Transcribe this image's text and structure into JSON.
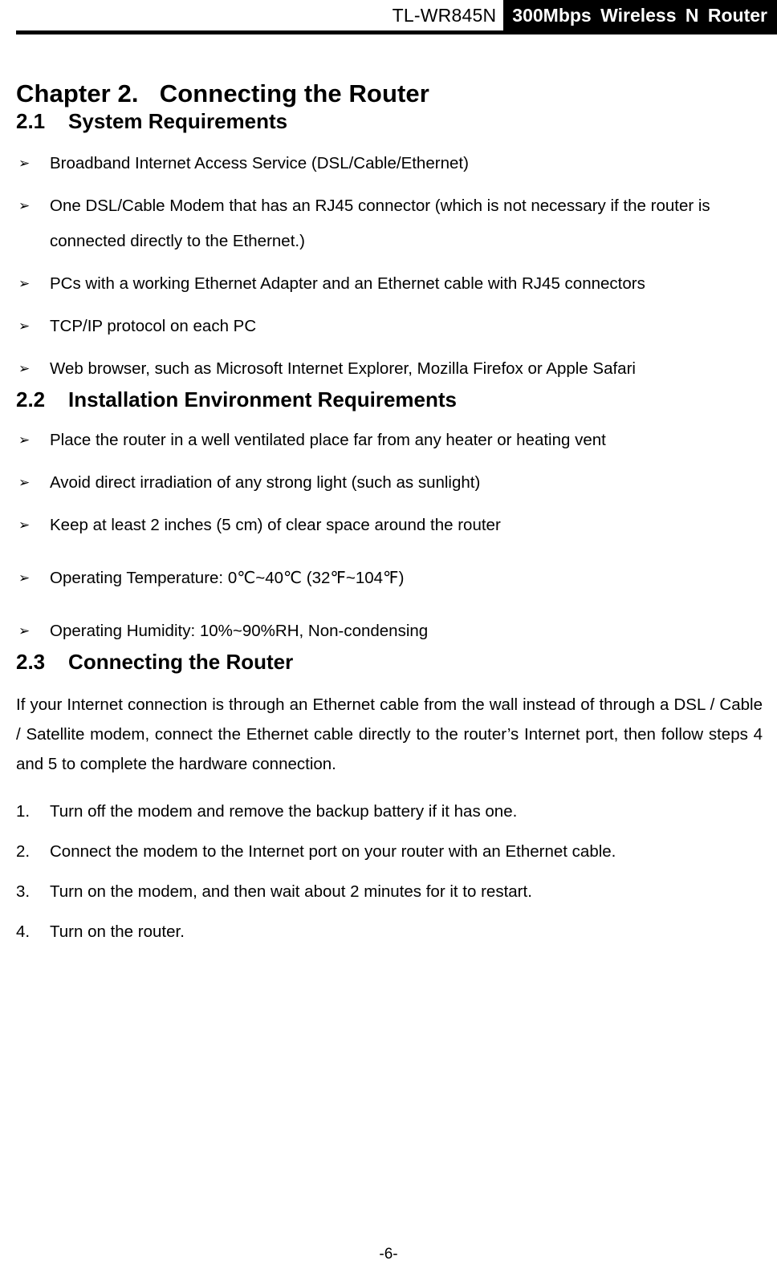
{
  "header": {
    "model": "TL-WR845N",
    "product": "300Mbps  Wireless  N  Router"
  },
  "chapter": {
    "title": "Chapter 2.   Connecting the Router"
  },
  "sections": [
    {
      "number": "2.1",
      "title": "2.1    System Requirements",
      "bullets": [
        "Broadband Internet Access Service (DSL/Cable/Ethernet)",
        "One DSL/Cable Modem that has an RJ45 connector (which is not necessary if the router is connected directly to the Ethernet.)",
        "PCs with a working Ethernet Adapter and an Ethernet cable with RJ45 connectors",
        "TCP/IP protocol on each PC",
        "Web browser, such as Microsoft Internet Explorer, Mozilla Firefox or Apple Safari"
      ]
    },
    {
      "number": "2.2",
      "title": "2.2    Installation Environment Requirements",
      "bullets": [
        "Place the router in a well ventilated place far from any heater or heating vent",
        "Avoid direct irradiation of any strong light (such as sunlight)",
        "Keep at least 2 inches (5 cm) of clear space around the router",
        "Operating Temperature: 0℃~40℃  (32℉~104℉)",
        "Operating Humidity: 10%~90%RH, Non-condensing"
      ]
    },
    {
      "number": "2.3",
      "title": "2.3    Connecting the Router",
      "paragraph": "If your Internet connection is through an Ethernet cable from the wall instead of through a DSL / Cable / Satellite modem, connect the Ethernet cable directly to the router’s Internet port, then",
      "paragraph_last_line": "follow steps 4 and 5 to complete the hardware connection.",
      "steps": [
        {
          "marker": "1.",
          "text": "Turn off the modem and remove the backup battery if it has one."
        },
        {
          "marker": "2.",
          "text": "Connect the modem to the Internet port on your router with an Ethernet cable."
        },
        {
          "marker": "3.",
          "text": "Turn on the modem, and then wait about 2 minutes for it to restart."
        },
        {
          "marker": "4.",
          "text": "Turn on the router."
        }
      ]
    }
  ],
  "bullet_glyph": "➢",
  "footer": {
    "page_number": "-6-"
  },
  "colors": {
    "band_background": "#000000",
    "band_text": "#ffffff",
    "text": "#000000",
    "page_background": "#ffffff"
  }
}
